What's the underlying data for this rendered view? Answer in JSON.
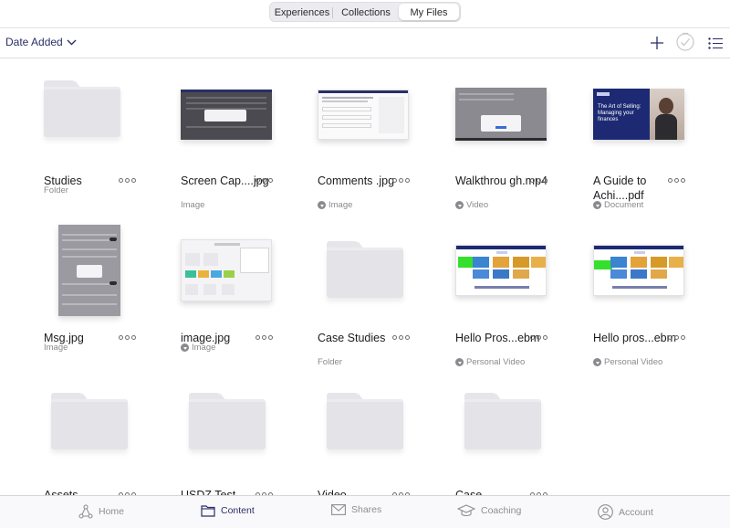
{
  "segmented": {
    "items": [
      "Experiences",
      "Collections",
      "My Files"
    ],
    "active": "My Files"
  },
  "sort": {
    "label": "Date Added"
  },
  "colors": {
    "accent": "#2a2f66",
    "muted": "#8a8a8e",
    "folder": "#e4e4e8"
  },
  "files": [
    {
      "name": "Studies",
      "sub": "Folder",
      "kind": "folder",
      "downloaded": false
    },
    {
      "name": "Screen Cap....jpg",
      "sub": "Image",
      "kind": "image",
      "downloaded": false
    },
    {
      "name": "Comments .jpg",
      "sub": "Image",
      "kind": "image",
      "downloaded": true
    },
    {
      "name": "Walkthrou gh.mp4",
      "sub": "Video",
      "kind": "video",
      "downloaded": true
    },
    {
      "name": "A Guide to Achi....pdf",
      "sub": "Document",
      "kind": "document",
      "downloaded": true
    },
    {
      "name": "Msg.jpg",
      "sub": "Image",
      "kind": "image",
      "downloaded": false
    },
    {
      "name": "image.jpg",
      "sub": "Image",
      "kind": "image",
      "downloaded": true
    },
    {
      "name": "Case Studies",
      "sub": "Folder",
      "kind": "folder",
      "downloaded": false
    },
    {
      "name": "Hello Pros...ebm",
      "sub": "Personal Video",
      "kind": "video",
      "downloaded": true
    },
    {
      "name": "Hello pros...ebm",
      "sub": "Personal Video",
      "kind": "video",
      "downloaded": true
    },
    {
      "name": "Assets",
      "sub": "",
      "kind": "folder",
      "downloaded": false
    },
    {
      "name": "USDZ Test",
      "sub": "",
      "kind": "folder",
      "downloaded": false
    },
    {
      "name": "Video",
      "sub": "",
      "kind": "folder",
      "downloaded": false
    },
    {
      "name": "Case",
      "sub": "",
      "kind": "folder",
      "downloaded": false
    }
  ],
  "guide_thumb": {
    "text": "The Art of Selling: Managing your finances"
  },
  "tabbar": {
    "items": [
      {
        "label": "Home",
        "icon": "home-network-icon"
      },
      {
        "label": "Content",
        "icon": "folder-icon"
      },
      {
        "label": "Shares",
        "icon": "envelope-icon"
      },
      {
        "label": "Coaching",
        "icon": "graduation-cap-icon"
      },
      {
        "label": "Account",
        "icon": "user-circle-icon"
      }
    ],
    "active": "Content"
  }
}
